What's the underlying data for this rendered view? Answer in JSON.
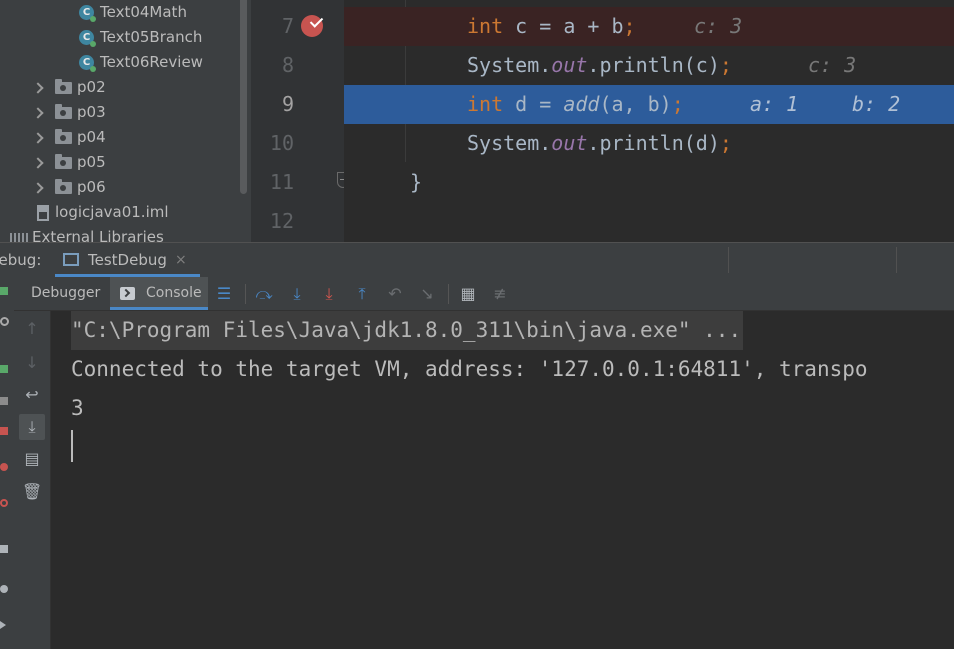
{
  "project_tree": {
    "items": [
      {
        "type": "class",
        "label": "Text04Math"
      },
      {
        "type": "class",
        "label": "Text05Branch"
      },
      {
        "type": "class",
        "label": "Text06Review"
      },
      {
        "type": "folder",
        "label": "p02"
      },
      {
        "type": "folder",
        "label": "p03"
      },
      {
        "type": "folder",
        "label": "p04"
      },
      {
        "type": "folder",
        "label": "p05"
      },
      {
        "type": "folder",
        "label": "p06"
      },
      {
        "type": "file",
        "label": "logicjava01.iml"
      },
      {
        "type": "library",
        "label": "External Libraries"
      }
    ]
  },
  "editor": {
    "line_numbers": [
      "7",
      "8",
      "9",
      "10",
      "11",
      "12"
    ],
    "current_line": "9",
    "lines": {
      "l7": {
        "kw": "int",
        "text": " c = a + b",
        "semi": ";",
        "hint": "c: 3"
      },
      "l8": {
        "obj": "System.",
        "field": "out",
        "call": ".println(c)",
        "semi": ";",
        "hint": "c: 3"
      },
      "l9": {
        "kw": "int",
        "text": " d = ",
        "method": "add",
        "args": "(a, b)",
        "semi": ";",
        "hint_a": "a: 1",
        "hint_b": "b: 2"
      },
      "l10": {
        "obj": "System.",
        "field": "out",
        "call": ".println(d)",
        "semi": ";"
      },
      "l11": {
        "text": "}"
      }
    }
  },
  "debug_window": {
    "title": "Debug:",
    "session_tab": "TestDebug",
    "close_glyph": "×",
    "tabs": {
      "debugger": "Debugger",
      "console": "Console"
    }
  },
  "console": {
    "lines": [
      "\"C:\\Program Files\\Java\\jdk1.8.0_311\\bin\\java.exe\" ...",
      "Connected to the target VM, address: '127.0.0.1:64811', transpo",
      "3"
    ]
  },
  "icons": {
    "toolbar": [
      "menu-icon",
      "step-over-icon",
      "step-into-icon",
      "force-step-into-icon",
      "step-out-icon",
      "drop-frame-icon",
      "run-to-cursor-icon",
      "evaluate-expression-icon",
      "trace-stream-icon"
    ],
    "console_side": [
      "up-arrow-icon",
      "down-arrow-icon",
      "soft-wrap-icon",
      "scroll-to-end-icon",
      "print-icon",
      "clear-icon"
    ]
  },
  "colors": {
    "keyword": "#cc7832",
    "field": "#9876aa",
    "exec_line": "#2d5c9b",
    "breakpoint": "#c75450",
    "tab_accent": "#4a88c7"
  }
}
